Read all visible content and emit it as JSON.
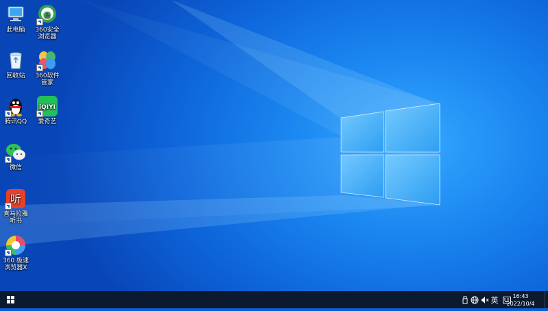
{
  "desktop": {
    "icons": [
      {
        "label": "此电脑"
      },
      {
        "label": "360安全浏览器"
      },
      {
        "label": "回收站"
      },
      {
        "label": "360软件管家"
      },
      {
        "label": "腾讯QQ"
      },
      {
        "label": "爱奇艺"
      },
      {
        "label": "微信"
      },
      {
        "label": "喜马拉雅听书"
      },
      {
        "label": "360 极速浏览器X"
      }
    ]
  },
  "taskbar": {
    "ime_label": "英",
    "clock_time": "16:43",
    "clock_date": "2022/10/4"
  },
  "colors": {
    "taskbar_bg": "#0b1a2e",
    "wallpaper_accent": "#35a8ff"
  },
  "icons": [
    "windows-logo-icon",
    "usb-icon",
    "network-icon",
    "volume-muted-icon",
    "keyboard-icon"
  ]
}
